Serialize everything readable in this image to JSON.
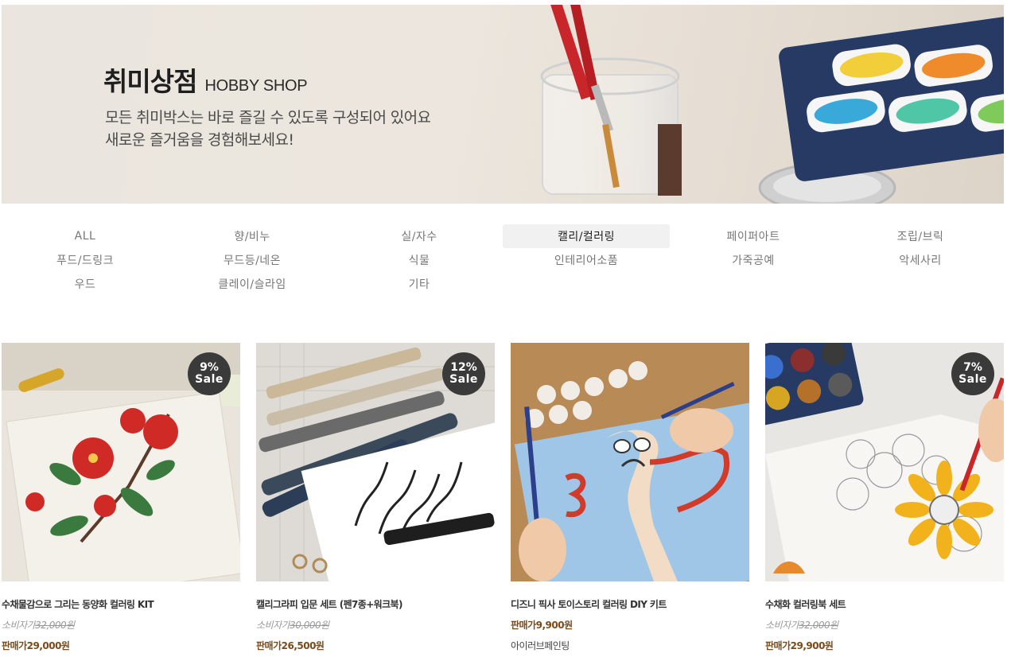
{
  "banner": {
    "title_ko": "취미상점",
    "title_en": "HOBBY SHOP",
    "subtitle_line1": "모든 취미박스는 바로 즐길 수 있도록 구성되어 있어요",
    "subtitle_line2": "새로운 즐거움을 경험해보세요!"
  },
  "categories": [
    {
      "label": "ALL"
    },
    {
      "label": "향/비누"
    },
    {
      "label": "실/자수"
    },
    {
      "label": "캘리/컬러링",
      "active": true
    },
    {
      "label": "페이퍼아트"
    },
    {
      "label": "조립/브릭"
    },
    {
      "label": "푸드/드링크"
    },
    {
      "label": "무드등/네온"
    },
    {
      "label": "식물"
    },
    {
      "label": "인테리어소품"
    },
    {
      "label": "가죽공예"
    },
    {
      "label": "악세사리"
    },
    {
      "label": "우드"
    },
    {
      "label": "클레이/슬라임"
    },
    {
      "label": "기타"
    }
  ],
  "products": [
    {
      "name": "수채물감으로 그리는 동양화 컬러링 KIT",
      "badge_pct": "9%",
      "badge_text": "Sale",
      "consumer_label": "소비자가",
      "consumer_price": "32,000원",
      "sell_label": "판매가",
      "sell_price": "29,000원",
      "icon": "camellia-painting"
    },
    {
      "name": "캘리그라피 입문 세트 (펜7종+워크북)",
      "badge_pct": "12%",
      "badge_text": "Sale",
      "consumer_label": "소비자가",
      "consumer_price": "30,000원",
      "sell_label": "판매가",
      "sell_price": "26,500원",
      "icon": "calligraphy-pens"
    },
    {
      "name": "디즈니 픽사 토이스토리 컬러링 DIY 키트",
      "sell_label": "판매가",
      "sell_price": "9,900원",
      "brand": "아이러브페인팅",
      "icon": "forky-painting"
    },
    {
      "name": "수채화 컬러링북 세트",
      "badge_pct": "7%",
      "badge_text": "Sale",
      "consumer_label": "소비자가",
      "consumer_price": "32,000원",
      "sell_label": "판매가",
      "sell_price": "29,900원",
      "icon": "sunflower-coloring"
    }
  ],
  "colors": {
    "sell_price": "#7a4a1a",
    "badge": "#3a3a3a",
    "active_category_bg": "#f1f1f1"
  }
}
